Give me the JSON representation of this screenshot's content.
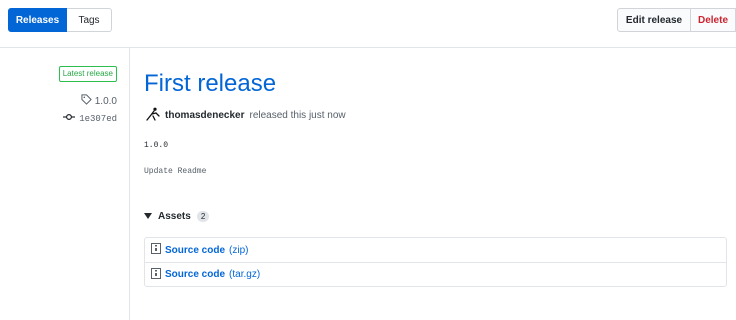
{
  "nav": {
    "releases_tab": "Releases",
    "tags_tab": "Tags",
    "edit_release": "Edit release",
    "delete": "Delete"
  },
  "release": {
    "latest_badge": "Latest release",
    "tag": "1.0.0",
    "commit": "1e307ed",
    "title": "First release",
    "author": "thomasdenecker",
    "meta_suffix": "released this just now",
    "body_version": "1.0.0",
    "body_message": "Update Readme"
  },
  "assets": {
    "heading": "Assets",
    "count": "2",
    "items": [
      {
        "name": "Source code",
        "ext": "(zip)",
        "icon": "file-zip-icon"
      },
      {
        "name": "Source code",
        "ext": "(tar.gz)",
        "icon": "file-zip-icon"
      }
    ]
  },
  "colors": {
    "primary": "#0366d6",
    "danger": "#cb2431",
    "success": "#28a745"
  }
}
